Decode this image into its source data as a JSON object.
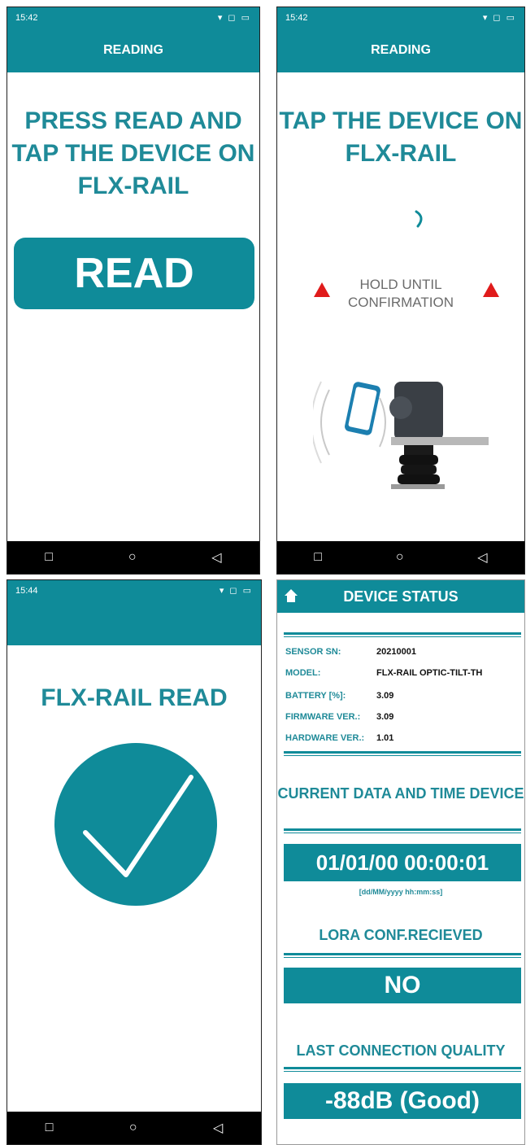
{
  "screen1": {
    "time": "15:42",
    "status_icons": "▾ ◻ ▭",
    "title": "READING",
    "headline": "PRESS READ AND TAP THE DEVICE ON FLX-RAIL",
    "button": "READ"
  },
  "screen2": {
    "time": "15:42",
    "status_icons": "▾ ◻ ▭",
    "title": "READING",
    "headline": "TAP THE DEVICE ON FLX-RAIL",
    "hold_line1": "HOLD UNTIL",
    "hold_line2": "CONFIRMATION"
  },
  "screen3": {
    "time": "15:44",
    "status_icons": "▾ ◻ ▭",
    "headline": "FLX-RAIL READ"
  },
  "screen4": {
    "title": "DEVICE STATUS",
    "info": [
      {
        "label": "SENSOR SN:",
        "value": "20210001"
      },
      {
        "label": "MODEL:",
        "value": "FLX-RAIL OPTIC-TILT-TH"
      },
      {
        "label": "BATTERY [%]:",
        "value": "3.09"
      },
      {
        "label": "FIRMWARE VER.:",
        "value": "3.09"
      },
      {
        "label": "HARDWARE VER.:",
        "value": "1.01"
      }
    ],
    "current_title": "CURRENT DATA AND TIME DEVICE",
    "datetime": "01/01/00 00:00:01",
    "datetime_format": "[dd/MM/yyyy hh:mm:ss]",
    "lora_title": "LORA CONF.RECIEVED",
    "lora_value": "NO",
    "quality_title": "LAST CONNECTION QUALITY",
    "quality_value": "-88dB (Good)"
  },
  "nav": {
    "square": "□",
    "circle": "○",
    "back": "◁"
  },
  "colors": {
    "teal": "#0f8b99",
    "warning": "#e01b1b"
  }
}
